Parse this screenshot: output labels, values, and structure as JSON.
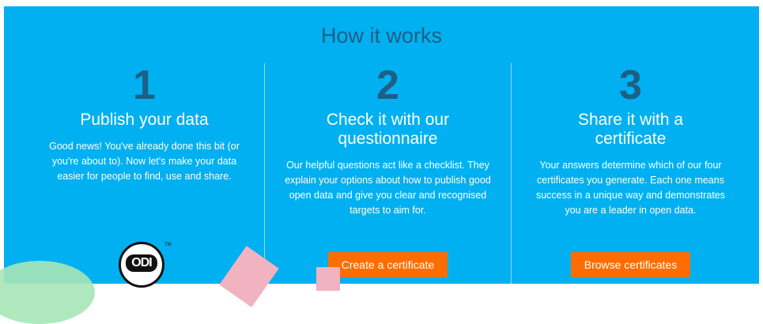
{
  "section": {
    "title": "How it works"
  },
  "steps": [
    {
      "number": "1",
      "heading_lines": [
        "Publish your data"
      ],
      "description": "Good news! You've already done this bit (or you're about to). Now let's make your data easier for people to find, use and share."
    },
    {
      "number": "2",
      "heading_lines": [
        "Check it with our",
        "questionnaire"
      ],
      "description": "Our helpful questions act like a checklist. They explain your options about how to publish good open data and give you clear and recognised targets to aim for.",
      "button_label": "Create a certificate"
    },
    {
      "number": "3",
      "heading_lines": [
        "Share it with a",
        "certificate"
      ],
      "description": "Your answers determine which of our four certificates you generate. Each one means success in a unique way and demonstrates you are a leader in open data.",
      "button_label": "Browse certificates"
    }
  ],
  "logo": {
    "text": "ODI",
    "tm": "TM"
  },
  "colors": {
    "panel": "#00b0f0",
    "accent": "#ff6d00",
    "title": "#1d5f86"
  }
}
